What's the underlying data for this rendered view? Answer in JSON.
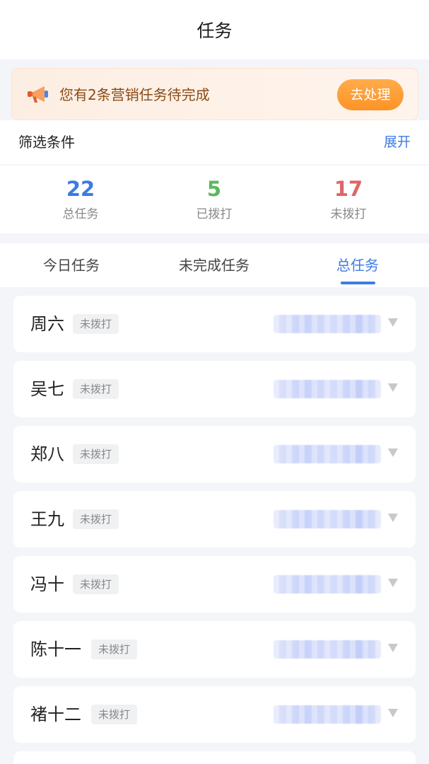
{
  "header": {
    "title": "任务"
  },
  "notice": {
    "message": "您有2条营销任务待完成",
    "action_label": "去处理"
  },
  "filter": {
    "label": "筛选条件",
    "expand_label": "展开"
  },
  "stats": [
    {
      "value": "22",
      "label": "总任务",
      "color": "#3d7ae4"
    },
    {
      "value": "5",
      "label": "已拨打",
      "color": "#5cb85c"
    },
    {
      "value": "17",
      "label": "未拨打",
      "color": "#e06565"
    }
  ],
  "tabs": [
    {
      "label": "今日任务",
      "active": false
    },
    {
      "label": "未完成任务",
      "active": false
    },
    {
      "label": "总任务",
      "active": true
    }
  ],
  "tasks": [
    {
      "name": "周六",
      "status": "未拨打"
    },
    {
      "name": "吴七",
      "status": "未拨打"
    },
    {
      "name": "郑八",
      "status": "未拨打"
    },
    {
      "name": "王九",
      "status": "未拨打"
    },
    {
      "name": "冯十",
      "status": "未拨打"
    },
    {
      "name": "陈十一",
      "status": "未拨打"
    },
    {
      "name": "褚十二",
      "status": "未拨打"
    }
  ],
  "colors": {
    "accent": "#3e7be6",
    "notice_button": "#fd9327"
  },
  "icons": {
    "notice": "megaphone-icon",
    "row_action": "triangle-down-icon"
  }
}
